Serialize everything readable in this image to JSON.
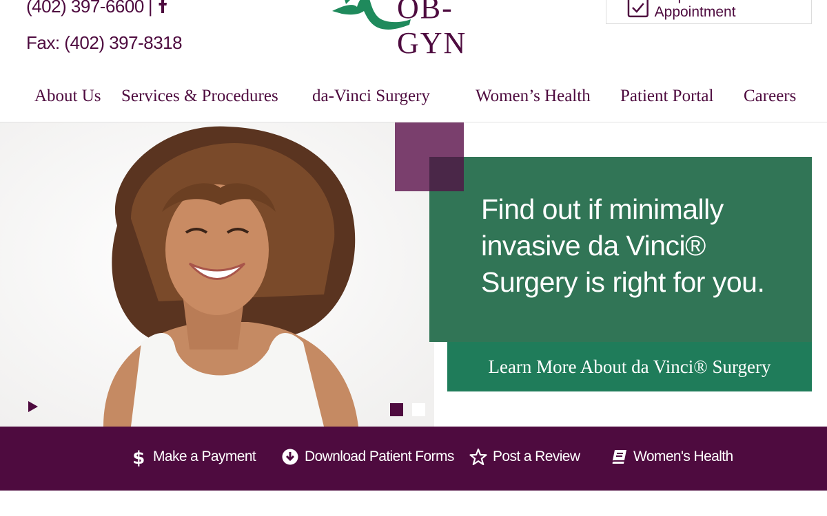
{
  "header": {
    "phone": "(402) 397-6600",
    "phone_separator": "|",
    "fax": "Fax: (402) 397-8318",
    "logo_text": "OB-GYN",
    "appointment_label": "Request an Appointment"
  },
  "nav": {
    "items": [
      {
        "label": "About Us"
      },
      {
        "label": "Services & Procedures"
      },
      {
        "label": "da-Vinci Surgery"
      },
      {
        "label": "Women’s Health"
      },
      {
        "label": "Patient Portal"
      },
      {
        "label": "Careers"
      }
    ]
  },
  "hero": {
    "headline": "Find out if minimally invasive da Vinci® Surgery is right for you.",
    "cta_label": "Learn More About da Vinci® Surgery",
    "slide_count": 2,
    "active_slide": 1
  },
  "quick_links": [
    {
      "label": "Make a Payment",
      "icon": "dollar-icon"
    },
    {
      "label": "Download Patient Forms",
      "icon": "download-circle-icon"
    },
    {
      "label": "Post a Review",
      "icon": "star-icon"
    },
    {
      "label": "Women's Health",
      "icon": "book-icon"
    }
  ],
  "colors": {
    "brand_purple": "#4e0b3f",
    "brand_green": "#317556",
    "cta_green": "#1f7c5a",
    "accent_plum": "#7a3f6d"
  }
}
